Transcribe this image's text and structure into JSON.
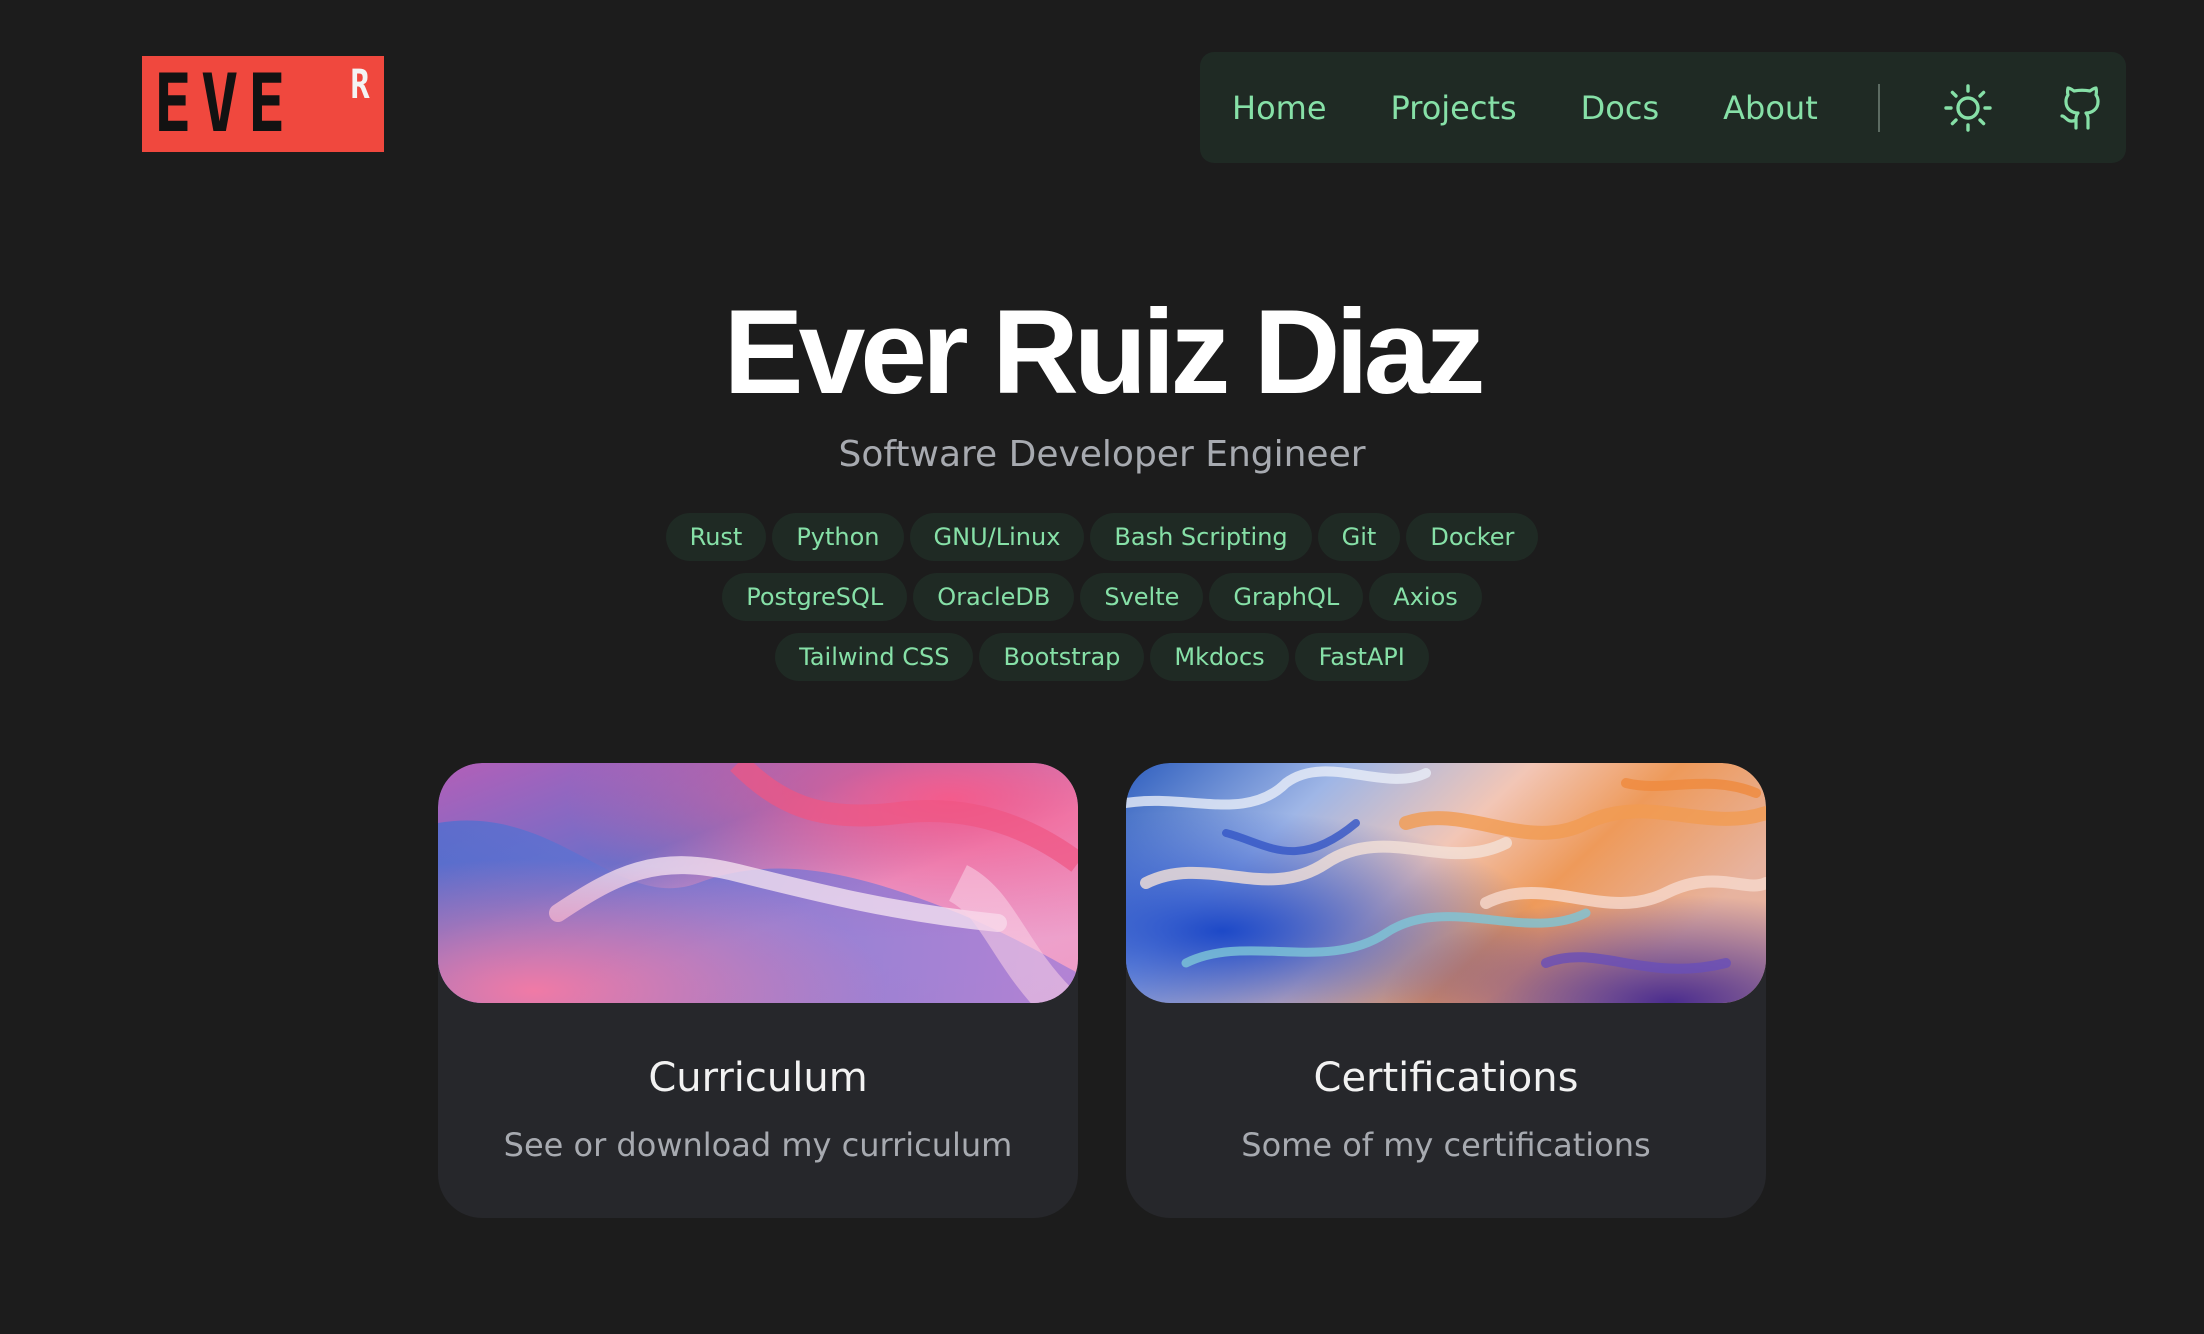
{
  "logo": {
    "letters": "EVE",
    "superscript": "R",
    "color": "#f0483e"
  },
  "nav": {
    "links": [
      "Home",
      "Projects",
      "Docs",
      "About"
    ],
    "icons": [
      "sun-icon",
      "github-icon"
    ],
    "accent": "#86e0a7"
  },
  "hero": {
    "name": "Ever Ruiz Diaz",
    "role": "Software Developer Engineer"
  },
  "tags": {
    "row1": [
      "Rust",
      "Python",
      "GNU/Linux",
      "Bash Scripting",
      "Git",
      "Docker"
    ],
    "row2": [
      "PostgreSQL",
      "OracleDB",
      "Svelte",
      "GraphQL",
      "Axios"
    ],
    "row3": [
      "Tailwind CSS",
      "Bootstrap",
      "Mkdocs",
      "FastAPI"
    ]
  },
  "cards": [
    {
      "title": "Curriculum",
      "description": "See or download my curriculum"
    },
    {
      "title": "Certifications",
      "description": "Some of my certifications"
    }
  ],
  "colors": {
    "background": "#1c1c1c",
    "nav_background": "#1f2a24",
    "card_background": "#26272b"
  }
}
